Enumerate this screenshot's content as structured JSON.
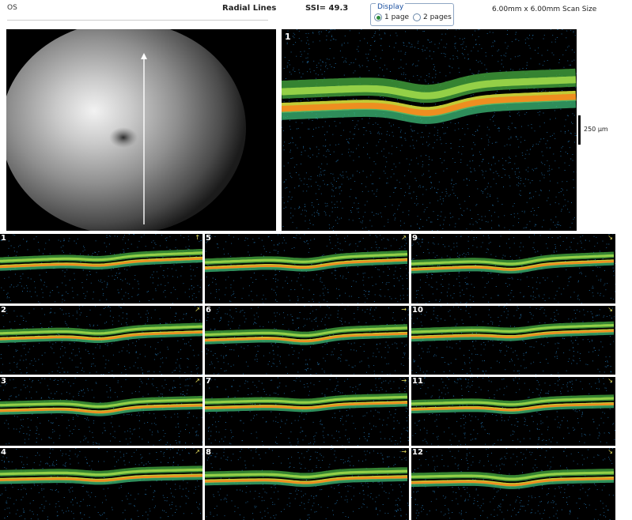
{
  "header": {
    "eye": "OS",
    "scan_name": "Radial Lines",
    "ssi": "SSI= 49.3",
    "display_label": "Display",
    "display_options": [
      "1 page",
      "2 pages"
    ],
    "display_selected": 0,
    "scan_size": "6.00mm x 6.00mm Scan Size"
  },
  "main_scan": {
    "number": "1",
    "scale_label": "250 µm"
  },
  "tiles": [
    {
      "label": "1",
      "arrow": "↑"
    },
    {
      "label": "2",
      "arrow": "↗"
    },
    {
      "label": "3",
      "arrow": "↗"
    },
    {
      "label": "4",
      "arrow": "↗"
    },
    {
      "label": "5",
      "arrow": "↗"
    },
    {
      "label": "6",
      "arrow": "→"
    },
    {
      "label": "7",
      "arrow": "→"
    },
    {
      "label": "8",
      "arrow": "→"
    },
    {
      "label": "9",
      "arrow": "↘"
    },
    {
      "label": "10",
      "arrow": "↘"
    },
    {
      "label": "11",
      "arrow": "↘"
    },
    {
      "label": "12",
      "arrow": "↘"
    }
  ],
  "colors": {
    "rnfl": "#9fd84a",
    "rpe": "#f08a20",
    "speckle": "#2a8ad0"
  }
}
